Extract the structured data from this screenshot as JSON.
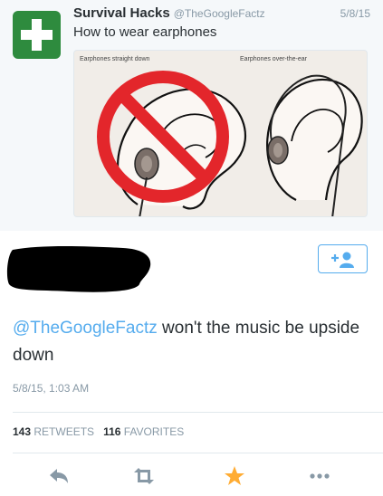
{
  "quoted_tweet": {
    "display_name": "Survival Hacks",
    "handle": "@TheGoogleFactz",
    "date": "5/8/15",
    "text": "How to wear earphones",
    "image": {
      "caption_left": "Earphones straight down",
      "caption_right": "Earphones over-the-ear"
    }
  },
  "reply": {
    "mention": "@TheGoogleFactz",
    "text_rest": " won't the music be upside down",
    "timestamp": "5/8/15, 1:03 AM",
    "retweet_count": "143",
    "retweet_label": "RETWEETS",
    "favorite_count": "116",
    "favorite_label": "FAVORITES"
  },
  "colors": {
    "twitter_blue": "#55acee",
    "favorite_star": "#ffac33",
    "avatar_green": "#2e8b3e",
    "prohibition_red": "#e3262b"
  },
  "icons": [
    "plus-cross-icon",
    "follow-person-icon",
    "reply-icon",
    "retweet-icon",
    "favorite-star-icon",
    "more-icon",
    "prohibition-icon"
  ]
}
